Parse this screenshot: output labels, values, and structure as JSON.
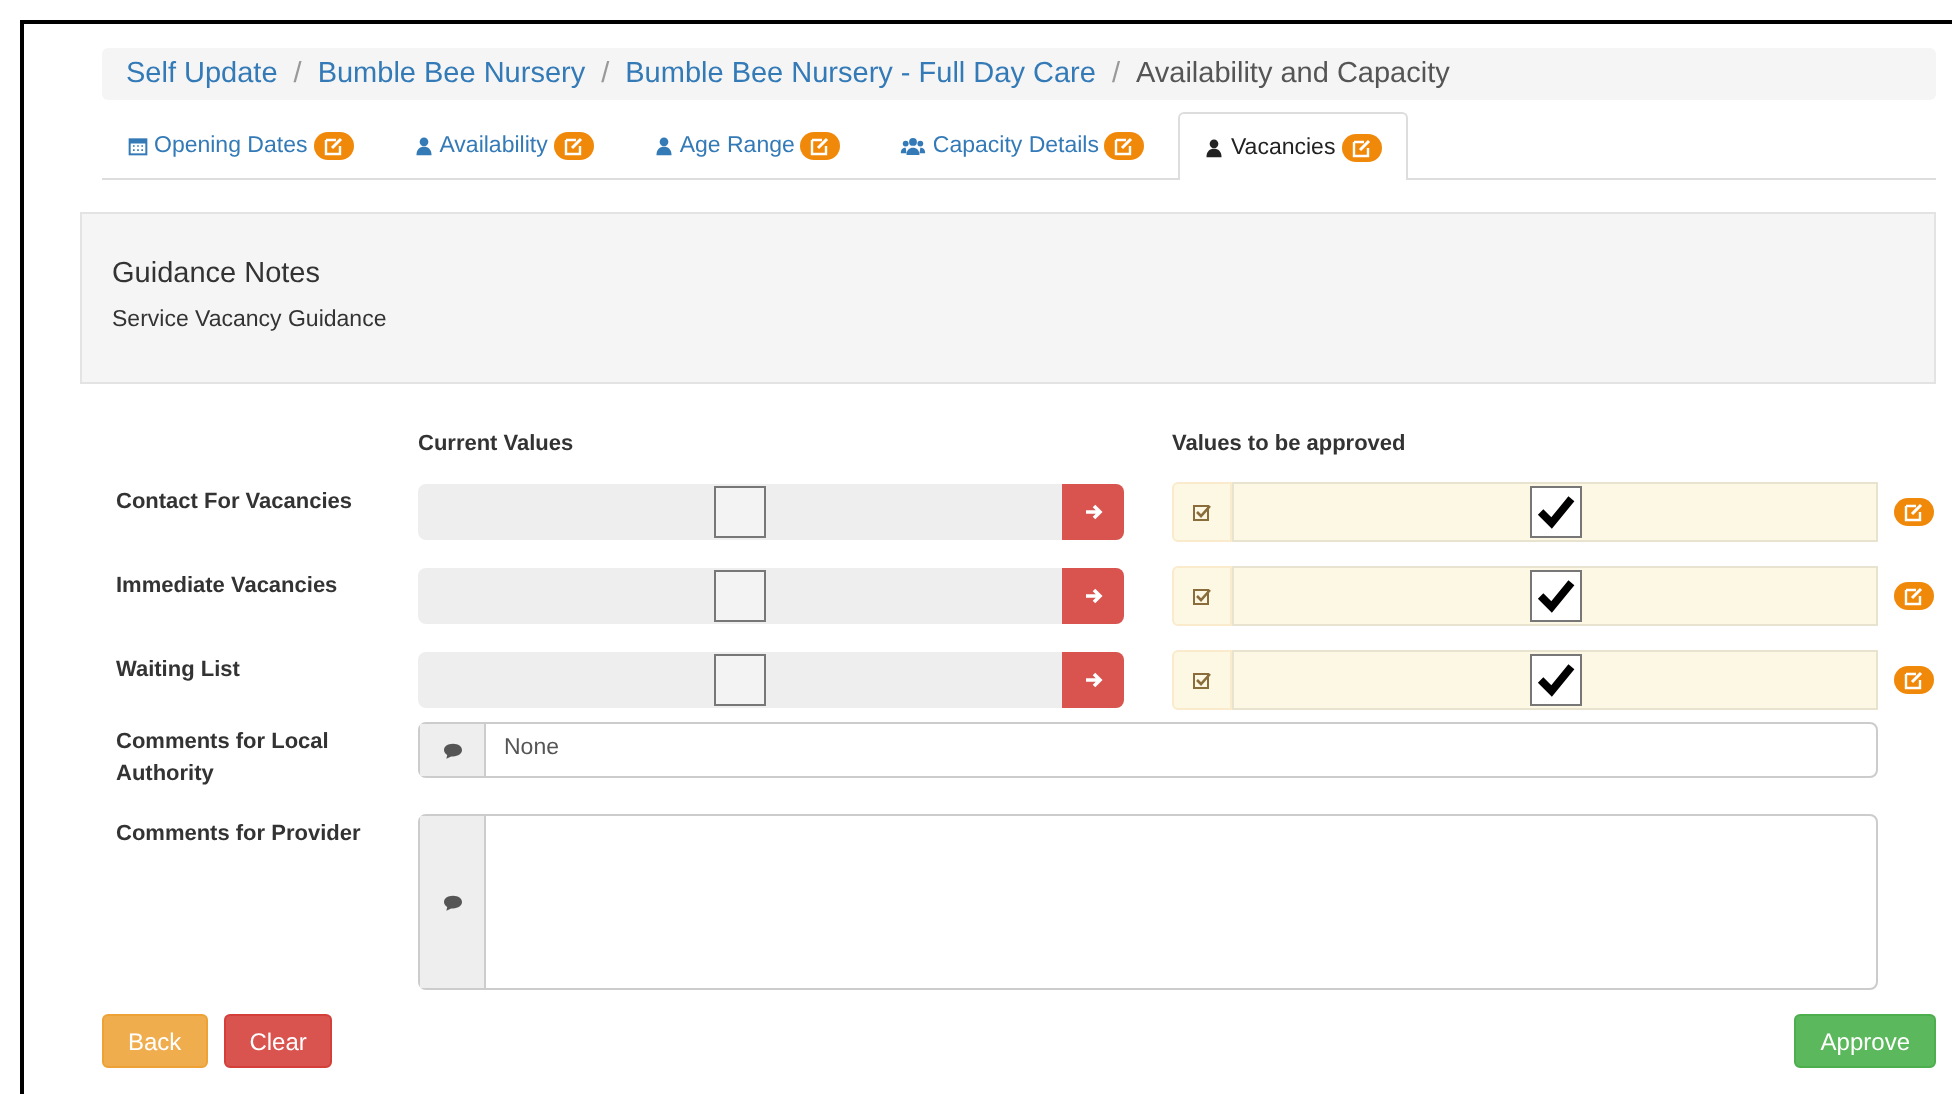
{
  "breadcrumb": [
    {
      "label": "Self Update",
      "link": true
    },
    {
      "separator": "/",
      "label": "Bumble Bee Nursery",
      "link": true
    },
    {
      "separator": "/",
      "label": "Bumble Bee Nursery - Full Day Care",
      "link": true
    },
    {
      "separator": "/",
      "label": "Availability and Capacity",
      "link": false
    }
  ],
  "tabs": [
    {
      "label": "Opening Dates",
      "kind": "calendar",
      "selected": false
    },
    {
      "label": "Availability",
      "kind": "user",
      "selected": false
    },
    {
      "label": "Age Range",
      "kind": "user",
      "selected": false
    },
    {
      "label": "Capacity Details",
      "kind": "users",
      "selected": false
    },
    {
      "label": "Vacancies",
      "kind": "user",
      "selected": true
    }
  ],
  "guidance": {
    "title": "Guidance Notes",
    "text": "Service Vacancy Guidance"
  },
  "columns": {
    "current": "Current Values",
    "approved": "Values to be approved"
  },
  "fields": [
    {
      "label": "Contact For Vacancies",
      "current_checked": false,
      "approved_checked": true
    },
    {
      "label": "Immediate Vacancies",
      "current_checked": false,
      "approved_checked": true
    },
    {
      "label": "Waiting List",
      "current_checked": false,
      "approved_checked": true
    }
  ],
  "comments": [
    {
      "label": "Comments for Local Authority",
      "kind": "input",
      "value": "None"
    },
    {
      "label": "Comments for Provider",
      "kind": "textarea"
    }
  ],
  "buttons": {
    "back": "Back",
    "clear": "Clear",
    "approve": "Approve"
  }
}
